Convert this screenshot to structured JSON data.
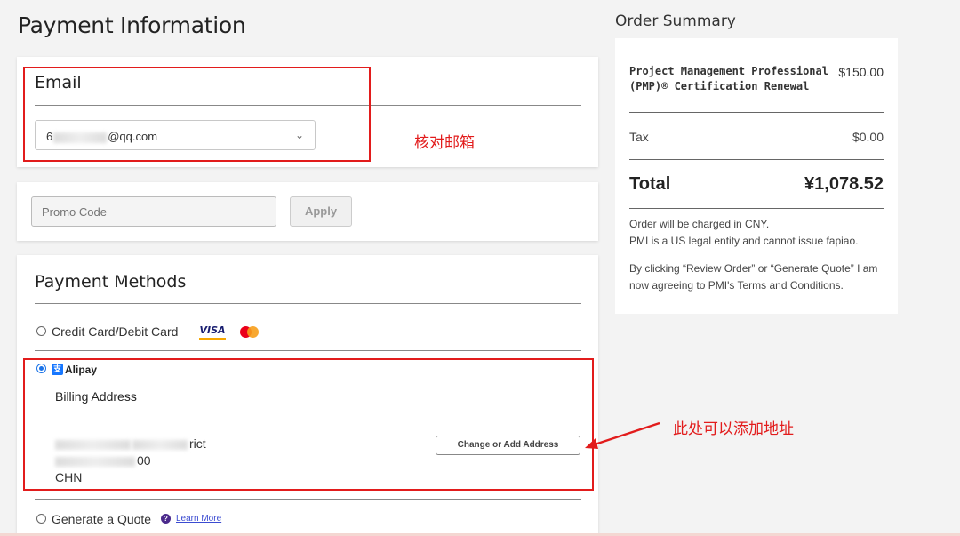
{
  "page": {
    "title": "Payment Information"
  },
  "email": {
    "title": "Email",
    "selected_prefix": "6",
    "selected_suffix": "@qq.com",
    "chevron": "chevron-down-icon"
  },
  "promo": {
    "placeholder": "Promo Code",
    "apply_label": "Apply"
  },
  "payment": {
    "title": "Payment Methods",
    "card_option": "Credit Card/Debit Card",
    "visa_label": "VISA",
    "alipay_label": "Alipay",
    "billing_title": "Billing Address",
    "address_line1_suffix": "rict",
    "address_line2_suffix": "00",
    "address_country": "CHN",
    "change_button": "Change or Add Address",
    "quote_option": "Generate a Quote",
    "help_icon": "?",
    "learn_more": "Learn More",
    "selected_method": "Alipay"
  },
  "annotations": {
    "email_note": "核对邮箱",
    "address_note": "此处可以添加地址",
    "color": "#e21c1c"
  },
  "summary": {
    "heading": "Order Summary",
    "item_name": "Project Management Professional (PMP)® Certification Renewal",
    "item_price": "$150.00",
    "tax_label": "Tax",
    "tax_value": "$0.00",
    "total_label": "Total",
    "total_value": "¥1,078.52",
    "note1": "Order will be charged in CNY.",
    "note2": "PMI is a US legal entity and cannot issue fapiao.",
    "note3": "By clicking “Review Order” or “Generate Quote” I am now agreeing to PMI's Terms and Conditions."
  }
}
